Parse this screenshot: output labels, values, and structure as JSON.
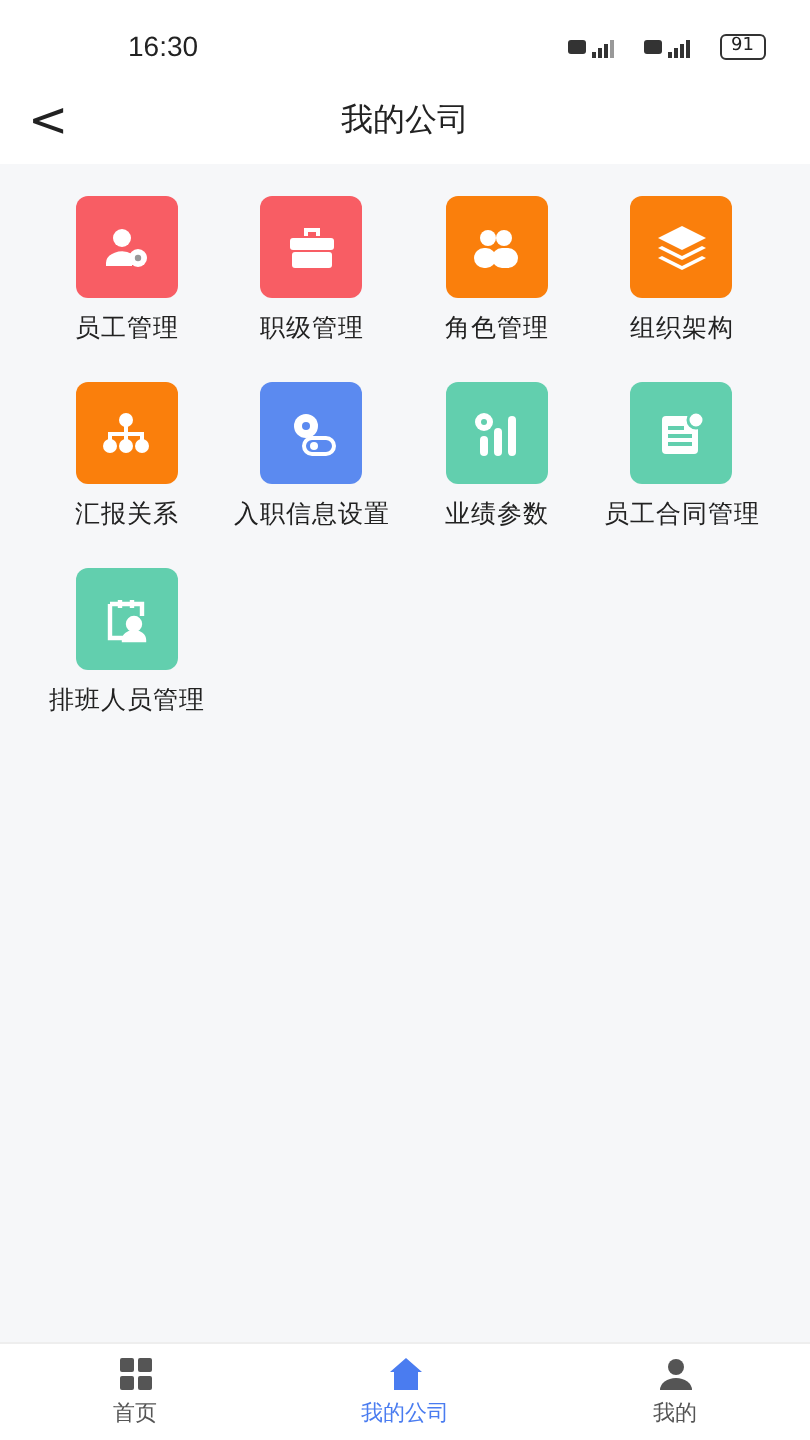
{
  "status_bar": {
    "time": "16:30",
    "battery": "91"
  },
  "header": {
    "back": "<",
    "title": "我的公司"
  },
  "items": [
    {
      "label": "员工管理",
      "kind": "person",
      "color": "#f85d64"
    },
    {
      "label": "职级管理",
      "kind": "toolbox",
      "color": "#f85d64"
    },
    {
      "label": "角色管理",
      "kind": "people",
      "color": "#fa7f0c"
    },
    {
      "label": "组织架构",
      "kind": "layers",
      "color": "#fa7f0c"
    },
    {
      "label": "汇报关系",
      "kind": "tree",
      "color": "#fa7f0c"
    },
    {
      "label": "入职信息设置",
      "kind": "gear",
      "color": "#5b8af0"
    },
    {
      "label": "业绩参数",
      "kind": "bars",
      "color": "#62cfae"
    },
    {
      "label": "员工合同管理",
      "kind": "doc",
      "color": "#62cfae"
    },
    {
      "label": "排班人员管理",
      "kind": "schedule",
      "color": "#62cfae"
    }
  ],
  "tabbar": [
    {
      "label": "首页",
      "kind": "grid",
      "selected": false
    },
    {
      "label": "我的公司",
      "kind": "home",
      "selected": true
    },
    {
      "label": "我的",
      "kind": "user",
      "selected": false
    }
  ]
}
